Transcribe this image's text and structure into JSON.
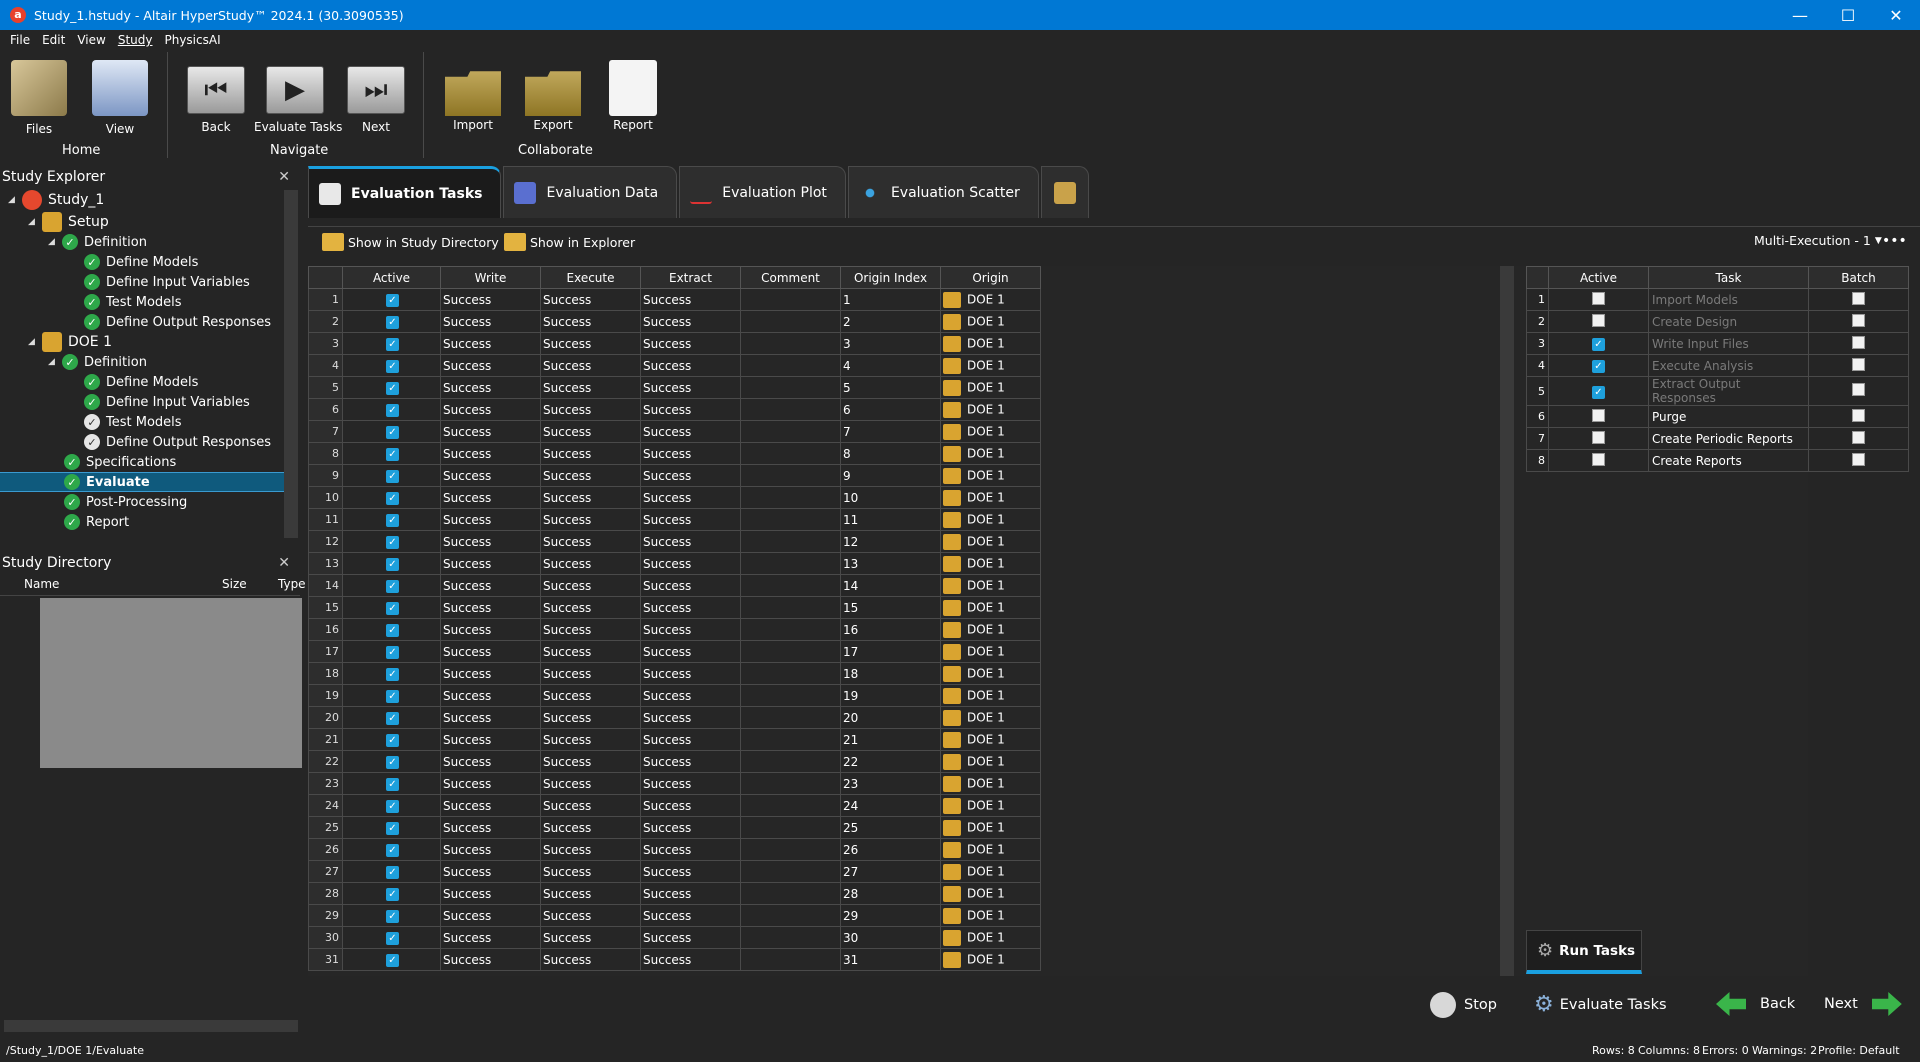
{
  "titlebar": {
    "title": "Study_1.hstudy - Altair HyperStudy™ 2024.1 (30.3090535)"
  },
  "menu": [
    "File",
    "Edit",
    "View",
    "Study",
    "PhysicsAI"
  ],
  "ribbon": {
    "files": "Files",
    "view": "View",
    "home_group": "Home",
    "back": "Back",
    "evaluate_tasks": "Evaluate Tasks",
    "next": "Next",
    "navigate_group": "Navigate",
    "import": "Import",
    "export": "Export",
    "report": "Report",
    "collaborate_group": "Collaborate"
  },
  "explorer": {
    "title": "Study Explorer",
    "nodes": [
      "Study_1",
      "Setup",
      "Definition",
      "Define Models",
      "Define Input Variables",
      "Test Models",
      "Define Output Responses",
      "DOE 1",
      "Definition",
      "Define Models",
      "Define Input Variables",
      "Test Models",
      "Define Output Responses",
      "Specifications",
      "Evaluate",
      "Post-Processing",
      "Report"
    ]
  },
  "studydir": {
    "title": "Study Directory",
    "col_name": "Name",
    "col_size": "Size",
    "col_type": "Type"
  },
  "tabs": [
    "Evaluation Tasks",
    "Evaluation Data",
    "Evaluation Plot",
    "Evaluation Scatter"
  ],
  "subtool": {
    "show_study_dir": "Show in Study Directory",
    "show_explorer": "Show in Explorer",
    "multi_exec": "Multi-Execution - 1"
  },
  "eval_table": {
    "headers": [
      "Active",
      "Write",
      "Execute",
      "Extract",
      "Comment",
      "Origin Index",
      "Origin"
    ],
    "status": "Success",
    "origin": "DOE 1",
    "rows": [
      1,
      2,
      3,
      4,
      5,
      6,
      7,
      8,
      9,
      10,
      11,
      12,
      13,
      14,
      15,
      16,
      17,
      18,
      19,
      20,
      21,
      22,
      23,
      24,
      25,
      26,
      27,
      28,
      29,
      30,
      31
    ]
  },
  "task_table": {
    "headers": [
      "Active",
      "Task",
      "Batch"
    ],
    "rows": [
      {
        "n": "1",
        "task": "Import Models",
        "active": false,
        "dim": true
      },
      {
        "n": "2",
        "task": "Create Design",
        "active": false,
        "dim": true
      },
      {
        "n": "3",
        "task": "Write Input Files",
        "active": true,
        "dim": true
      },
      {
        "n": "4",
        "task": "Execute Analysis",
        "active": true,
        "dim": true
      },
      {
        "n": "5",
        "task": "Extract Output Responses",
        "active": true,
        "dim": true
      },
      {
        "n": "6",
        "task": "Purge",
        "active": false,
        "dim": false
      },
      {
        "n": "7",
        "task": "Create Periodic Reports",
        "active": false,
        "dim": false
      },
      {
        "n": "8",
        "task": "Create Reports",
        "active": false,
        "dim": false
      }
    ]
  },
  "run_tasks": "Run Tasks",
  "bottom": {
    "stop": "Stop",
    "evaluate_tasks": "Evaluate Tasks",
    "back": "Back",
    "next": "Next"
  },
  "status": {
    "path": "/Study_1/DOE 1/Evaluate",
    "rows": "Rows: 8",
    "columns": "Columns: 8",
    "errors": "Errors: 0",
    "warnings": "Warnings: 2",
    "profile": "Profile: Default"
  }
}
